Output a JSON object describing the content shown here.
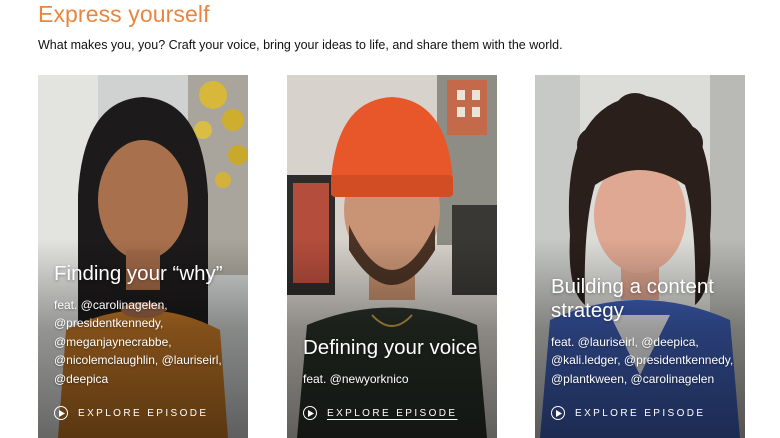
{
  "header": {
    "title": "Express yourself",
    "subtitle": "What makes you, you? Craft your voice, bring your ideas to life, and share them with the world."
  },
  "colors": {
    "accent": "#e8863f"
  },
  "cards": [
    {
      "title": "Finding your “why”",
      "feat": "feat. @carolinagelen, @presidentkennedy, @meganjaynecrabbe, @nicolemclaughlin, @lauriseirl, @deepica",
      "cta": "EXPLORE EPISODE",
      "icon": "play-circle-icon"
    },
    {
      "title": "Defining your voice",
      "feat": "feat. @newyorknico",
      "cta": "EXPLORE EPISODE",
      "icon": "play-circle-icon"
    },
    {
      "title": "Building a content strategy",
      "feat": "feat. @lauriseirl, @deepica, @kali.ledger, @presidentkennedy, @plantkween, @carolinagelen",
      "cta": "EXPLORE EPISODE",
      "icon": "play-circle-icon"
    }
  ]
}
